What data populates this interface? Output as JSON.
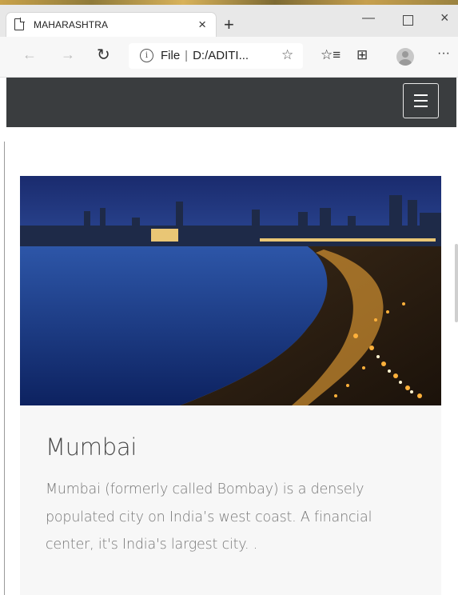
{
  "browser": {
    "tab_title": "MAHARASHTRA",
    "tab_close": "×",
    "new_tab": "+",
    "win_minimize": "—",
    "win_close": "×",
    "address_scheme": "File",
    "address_path": "D:/ADITI...",
    "icons": [
      "back-icon",
      "forward-icon",
      "refresh-icon",
      "info-icon",
      "star-icon",
      "favorites-icon",
      "collections-icon",
      "profile-icon",
      "more-icon"
    ]
  },
  "site": {
    "menu_icon": "hamburger-icon"
  },
  "card": {
    "image_alt": "Mumbai Marine Drive skyline at dusk",
    "title": "Mumbai",
    "description": "Mumbai (formerly called Bombay) is a densely populated city on India’s west coast. A financial center, it's India's largest city. ."
  },
  "colors": {
    "site_nav": "#3a3d3f",
    "card_bg": "#f7f7f7",
    "text": "#777777"
  }
}
